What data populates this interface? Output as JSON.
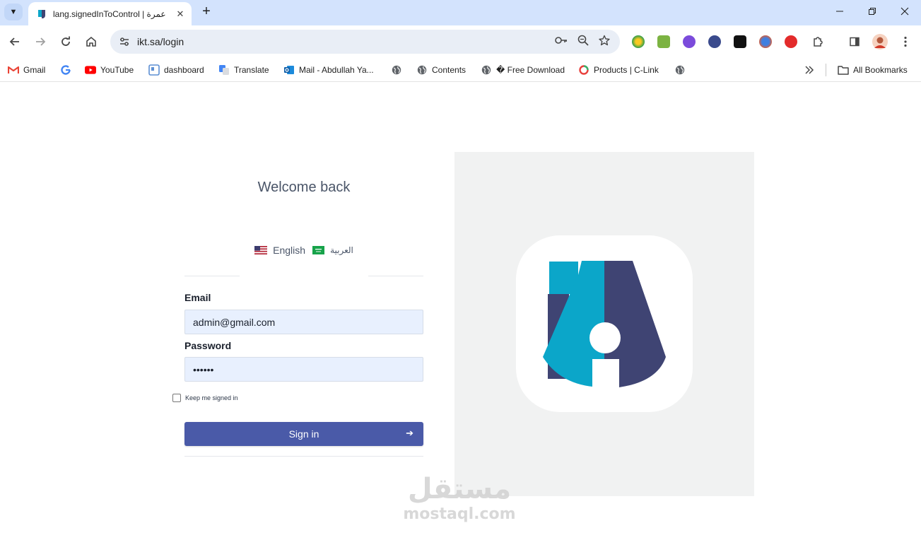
{
  "browser": {
    "tab": {
      "title": "lang.signedInToControl | عمرة"
    },
    "url": "ikt.sa/login"
  },
  "bookmarks": [
    {
      "label": "Gmail",
      "icon": "gmail-icon"
    },
    {
      "label": "",
      "icon": "google-icon"
    },
    {
      "label": "YouTube",
      "icon": "youtube-icon"
    },
    {
      "label": "dashboard",
      "icon": "dashboard-icon"
    },
    {
      "label": "Translate",
      "icon": "translate-icon"
    },
    {
      "label": "Mail - Abdullah Ya...",
      "icon": "outlook-icon"
    },
    {
      "label": "",
      "icon": "globe-icon"
    },
    {
      "label": "Contents",
      "icon": "globe-icon"
    },
    {
      "label": "� Free Download",
      "icon": "globe-icon"
    },
    {
      "label": "Products | C-Link",
      "icon": "clink-icon"
    },
    {
      "label": "",
      "icon": "globe-icon"
    }
  ],
  "all_bookmarks": "All Bookmarks",
  "login": {
    "heading": "Welcome back",
    "languages": [
      {
        "label": "English",
        "flag": "us-flag-icon"
      },
      {
        "label": "العربية",
        "flag": "sa-flag-icon"
      }
    ],
    "email_label": "Email",
    "email_value": "admin@gmail.com",
    "password_label": "Password",
    "password_value": "••••••",
    "remember_label": "Keep me signed in",
    "signin_label": "Sign in",
    "signin_arrow": "➔"
  },
  "watermark": {
    "arabic": "مستقل",
    "latin": "mostaql.com"
  },
  "colors": {
    "primary_button": "#4a5aa8",
    "logo_cyan": "#0ba6c9",
    "logo_navy": "#3f4473",
    "panel": "#f1f2f2",
    "input_bg": "#e8f0fe"
  }
}
